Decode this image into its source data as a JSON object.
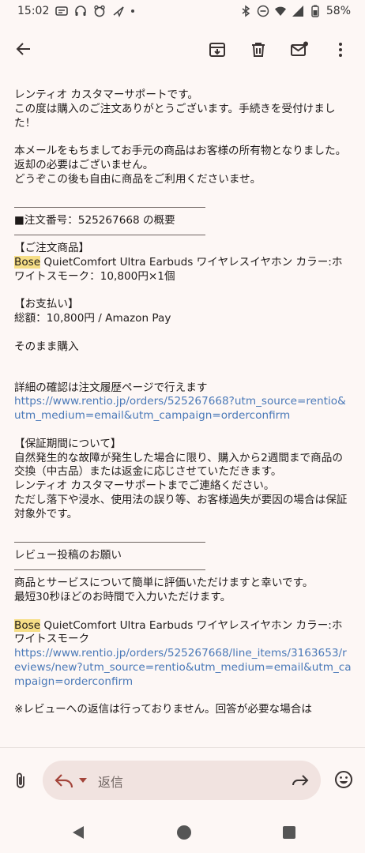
{
  "status_bar": {
    "time": "15:02",
    "battery": "58%"
  },
  "app_bar": {
    "icons": [
      "back-arrow-icon",
      "archive-icon",
      "delete-icon",
      "mark-unread-icon",
      "more-vert-icon"
    ]
  },
  "email": {
    "intro_line1": "レンティオ カスタマーサポートです。",
    "intro_line2": "この度は購入のご注文ありがとうございます。手続きを受付けました！",
    "ownership_1": "本メールをもちましてお手元の商品はお客様の所有物となりました。返却の必要はございません。",
    "ownership_2": "どうぞこの後も自由に商品をご利用くださいませ。",
    "order_heading": "■注文番号：525267668 の概要",
    "product_label": "【ご注文商品】",
    "product_brand": "Bose",
    "product_name": " QuietComfort Ultra Earbuds ワイヤレスイヤホン カラー:ホワイトスモーク：10,800円×1個",
    "payment_label": "【お支払い】",
    "payment_total": "総額：10,800円 / Amazon Pay",
    "purchase_type": "そのまま購入",
    "history_text": "詳細の確認は注文履歴ページで行えます",
    "order_link": "https://www.rentio.jp/orders/525267668?utm_source=rentio&utm_medium=email&utm_campaign=orderconfirm",
    "warranty_label": "【保証期間について】",
    "warranty_1": "自然発生的な故障が発生した場合に限り、購入から2週間まで商品の交換（中古品）または返金に応じさせていただきます。",
    "warranty_2": "レンティオ カスタマーサポートまでご連絡ください。",
    "warranty_3": "ただし落下や浸水、使用法の誤り等、お客様過失が要因の場合は保証対象外です。",
    "review_heading": "レビュー投稿のお願い",
    "review_text_1": "商品とサービスについて簡単に評価いただけますと幸いです。",
    "review_text_2": "最短30秒ほどのお時間で入力いただけます。",
    "review_brand": "Bose",
    "review_product": " QuietComfort Ultra Earbuds ワイヤレスイヤホン カラー:ホワイトスモーク",
    "review_link": "https://www.rentio.jp/orders/525267668/line_items/3163653/reviews/new?utm_source=rentio&utm_medium=email&utm_campaign=orderconfirm",
    "review_note": "※レビューへの返信は行っておりません。回答が必要な場合は"
  },
  "reply_bar": {
    "reply_label": "返信"
  },
  "colors": {
    "background": "#fdf7f5",
    "link": "#4a79b8",
    "highlight": "#f6de86",
    "reply_pill": "#f1e3e0",
    "reply_accent": "#a3443a"
  }
}
